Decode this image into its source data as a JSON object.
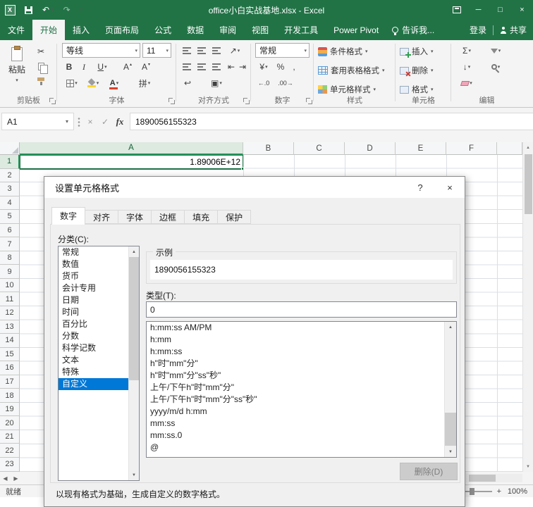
{
  "icons": {
    "dropdown": "▾",
    "undo": "↶",
    "redo": "↷",
    "minimize": "─",
    "maximize": "□",
    "close": "×",
    "cut": "✂",
    "bold": "B",
    "italic": "I",
    "underline": "U",
    "letter_a": "A",
    "tri_up": "▴",
    "tri_down": "▾",
    "orientation": "↗",
    "wrap": "↩",
    "indent_left": "⇤",
    "indent_right": "⇥",
    "merge": "▣",
    "accounting": "¥",
    "percent": "%",
    "comma": ",",
    "dec_increase": "←.0",
    "dec_decrease": ".00→",
    "sigma": "Σ",
    "fill_down": "↓",
    "cancel": "×",
    "check": "✓",
    "fx": "fx",
    "help": "?",
    "scroll_up": "▲",
    "scroll_down": "▼",
    "nav_left": "◀",
    "nav_right": "▶",
    "zoom_minus": "−",
    "zoom_plus": "+"
  },
  "title_bar": {
    "title": "office小白实战基地.xlsx - Excel"
  },
  "ribbon": {
    "tabs": [
      "文件",
      "开始",
      "插入",
      "页面布局",
      "公式",
      "数据",
      "审阅",
      "视图",
      "开发工具",
      "Power Pivot"
    ],
    "active_tab": "开始",
    "tell_me": "告诉我...",
    "sign_in": "登录",
    "share": "共享",
    "clipboard": {
      "label": "剪贴板",
      "paste": "粘贴"
    },
    "font": {
      "label": "字体",
      "name": "等线",
      "size": "11",
      "phonetic": "拼"
    },
    "alignment": {
      "label": "对齐方式"
    },
    "number": {
      "label": "数字",
      "format": "常规"
    },
    "styles": {
      "label": "样式",
      "items": [
        "条件格式",
        "套用表格格式",
        "单元格样式"
      ]
    },
    "cells": {
      "label": "单元格",
      "items": [
        "插入",
        "删除",
        "格式"
      ]
    },
    "editing": {
      "label": "编辑"
    }
  },
  "formula_bar": {
    "name_box": "A1",
    "formula": "1890056155323"
  },
  "grid": {
    "columns": [
      "A",
      "B",
      "C",
      "D",
      "E",
      "F"
    ],
    "row_count": 23,
    "selected_cell": "A1",
    "a1_value": "1.89006E+12"
  },
  "dialog": {
    "title": "设置单元格格式",
    "tabs": [
      "数字",
      "对齐",
      "字体",
      "边框",
      "填充",
      "保护"
    ],
    "active_tab": "数字",
    "category_label": "分类(C):",
    "categories": [
      "常规",
      "数值",
      "货币",
      "会计专用",
      "日期",
      "时间",
      "百分比",
      "分数",
      "科学记数",
      "文本",
      "特殊",
      "自定义"
    ],
    "selected_category": "自定义",
    "example_label": "示例",
    "example_value": "1890056155323",
    "type_label": "类型(T):",
    "type_value": "0",
    "format_codes": [
      "h:mm:ss AM/PM",
      "h:mm",
      "h:mm:ss",
      "h\"时\"mm\"分\"",
      "h\"时\"mm\"分\"ss\"秒\"",
      "上午/下午h\"时\"mm\"分\"",
      "上午/下午h\"时\"mm\"分\"ss\"秒\"",
      "yyyy/m/d h:mm",
      "mm:ss",
      "mm:ss.0",
      "@"
    ],
    "delete_button": "删除(D)",
    "hint": "以现有格式为基础，生成自定义的数字格式。"
  },
  "status_bar": {
    "status": "就绪",
    "zoom": "100%"
  }
}
